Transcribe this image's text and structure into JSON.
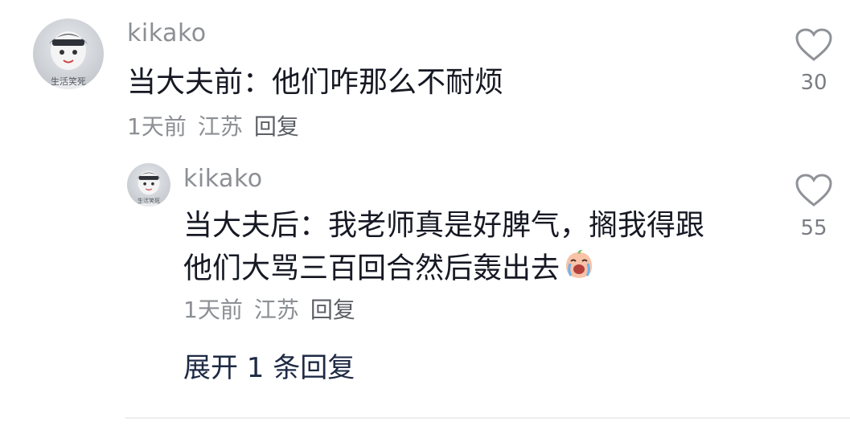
{
  "comment": {
    "username": "kikako",
    "avatar_text": "生活笑死",
    "text": "当大夫前：他们咋那么不耐烦",
    "time": "1天前",
    "location": "江苏",
    "reply_label": "回复",
    "like_count": "30",
    "like_icon": "heart-outline-icon"
  },
  "reply": {
    "username": "kikako",
    "avatar_text": "生活笑死",
    "line1": "当大夫后：我老师真是好脾气，搁我得跟",
    "line2": "他们大骂三百回合然后轰出去",
    "emoji": "laughing-crying-peach-emoji",
    "time": "1天前",
    "location": "江苏",
    "reply_label": "回复",
    "like_count": "55",
    "like_icon": "heart-outline-icon"
  },
  "expand_label": "展开 1 条回复",
  "colors": {
    "text_primary": "#161823",
    "text_secondary": "#8c8f94",
    "expand": "#1e2a44"
  }
}
